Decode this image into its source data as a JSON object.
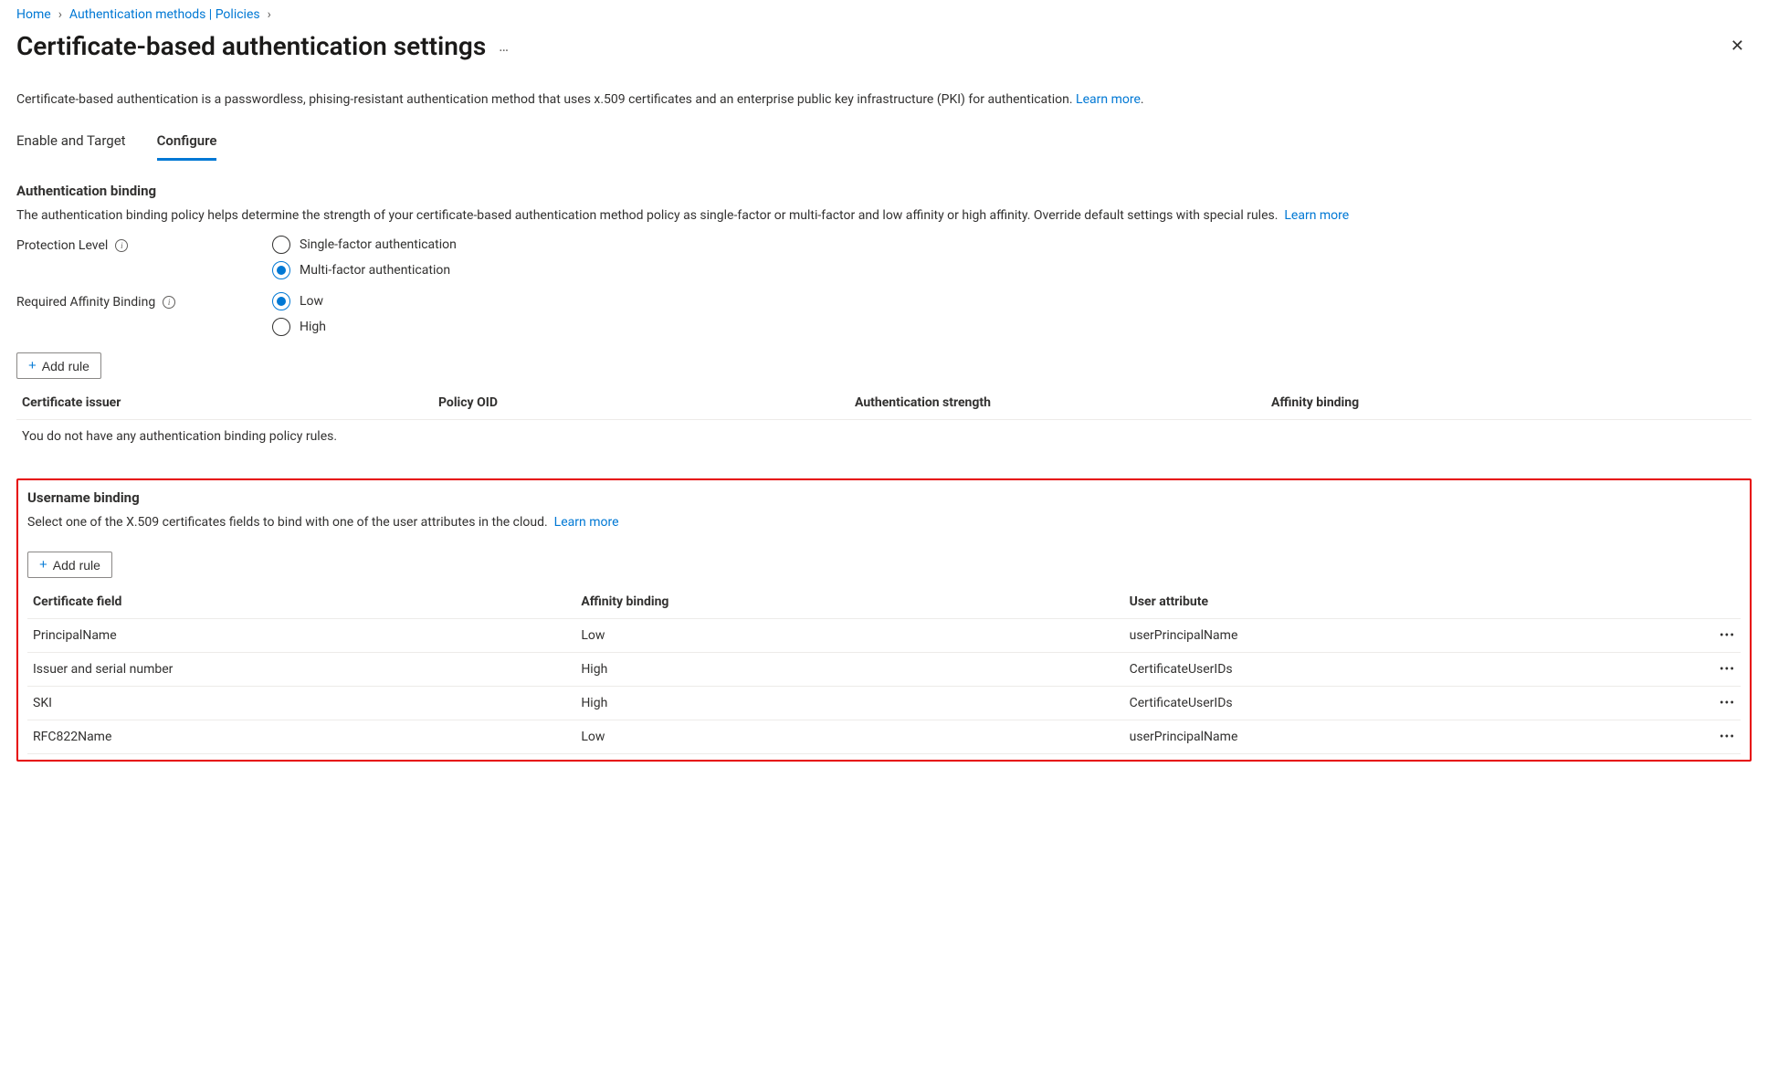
{
  "breadcrumb": {
    "home": "Home",
    "auth_methods": "Authentication methods | Policies"
  },
  "page": {
    "title": "Certificate-based authentication settings",
    "description": "Certificate-based authentication is a passwordless, phising-resistant authentication method that uses x.509 certificates and an enterprise public key infrastructure (PKI) for authentication.",
    "learn_more": "Learn more"
  },
  "tabs": {
    "enable": "Enable and Target",
    "configure": "Configure"
  },
  "auth_binding": {
    "heading": "Authentication binding",
    "body": "The authentication binding policy helps determine the strength of your certificate-based authentication method policy as single-factor or multi-factor and low affinity or high affinity. Override default settings with special rules.",
    "learn_more": "Learn more",
    "protection_label": "Protection Level",
    "protection_options": {
      "single": "Single-factor authentication",
      "multi": "Multi-factor authentication"
    },
    "affinity_label": "Required Affinity Binding",
    "affinity_options": {
      "low": "Low",
      "high": "High"
    },
    "add_rule": "Add rule",
    "columns": {
      "issuer": "Certificate issuer",
      "oid": "Policy OID",
      "strength": "Authentication strength",
      "affinity": "Affinity binding"
    },
    "empty": "You do not have any authentication binding policy rules."
  },
  "user_binding": {
    "heading": "Username binding",
    "body": "Select one of the X.509 certificates fields to bind with one of the user attributes in the cloud.",
    "learn_more": "Learn more",
    "add_rule": "Add rule",
    "columns": {
      "field": "Certificate field",
      "affinity": "Affinity binding",
      "attr": "User attribute"
    },
    "rows": [
      {
        "field": "PrincipalName",
        "affinity": "Low",
        "attr": "userPrincipalName"
      },
      {
        "field": "Issuer and serial number",
        "affinity": "High",
        "attr": "CertificateUserIDs"
      },
      {
        "field": "SKI",
        "affinity": "High",
        "attr": "CertificateUserIDs"
      },
      {
        "field": "RFC822Name",
        "affinity": "Low",
        "attr": "userPrincipalName"
      }
    ]
  }
}
